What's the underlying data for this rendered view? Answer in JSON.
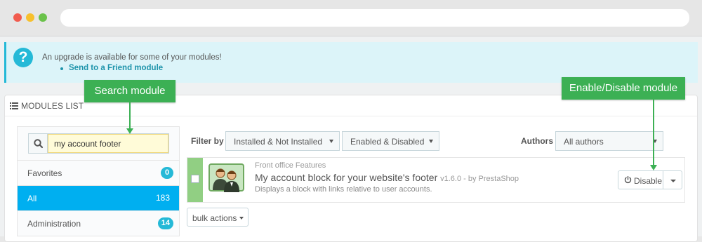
{
  "alert": {
    "message": "An upgrade is available for some of your modules!",
    "link": "Send to a Friend module"
  },
  "panel": {
    "title": "MODULES LIST"
  },
  "search": {
    "value": "my account footer"
  },
  "categories": [
    {
      "label": "Favorites",
      "count": "0"
    },
    {
      "label": "All",
      "count": "183"
    },
    {
      "label": "Administration",
      "count": "14"
    }
  ],
  "filters": {
    "label": "Filter by",
    "install_state": "Installed & Not Installed",
    "enable_state": "Enabled & Disabled",
    "authors_label": "Authors",
    "authors_value": "All authors"
  },
  "module": {
    "category": "Front office Features",
    "title": "My account block for your website's footer",
    "version": "v1.6.0 - by PrestaShop",
    "description": "Displays a block with links relative to user accounts.",
    "action": "Disable"
  },
  "bulk": {
    "label": "bulk actions"
  },
  "callouts": {
    "search": "Search module",
    "toggle": "Enable/Disable module"
  },
  "colors": {
    "accent": "#25b9d7",
    "active": "#00aff0",
    "callout": "#3cb054"
  }
}
